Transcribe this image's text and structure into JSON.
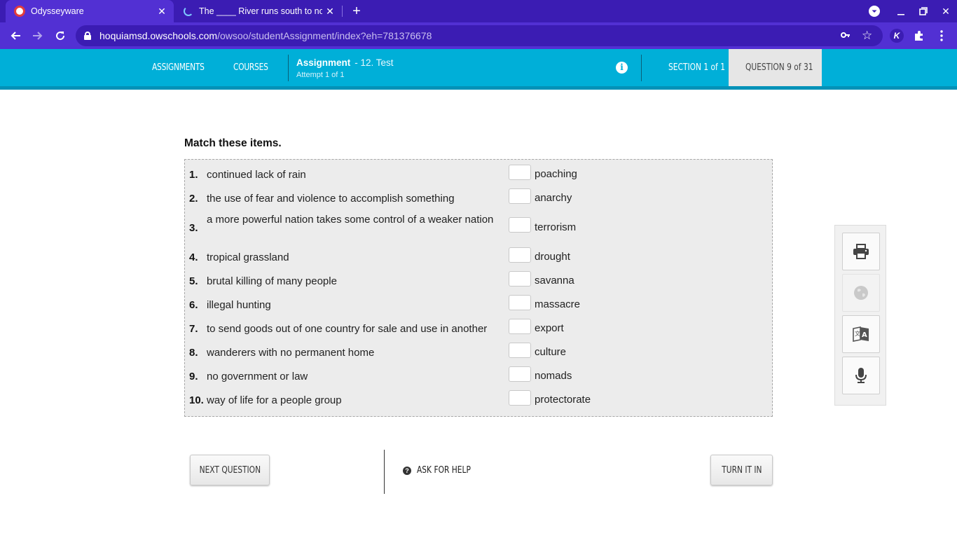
{
  "browser": {
    "tabs": [
      {
        "title": "Odysseyware",
        "active": true
      },
      {
        "title": "The ____ River runs south to nor",
        "active": false
      }
    ],
    "url_domain": "hoquiamsd.owschools.com",
    "url_path": "/owsoo/studentAssignment/index?eh=781376678",
    "accent_color": "#5230d3"
  },
  "header": {
    "nav": [
      "ASSIGNMENTS",
      "COURSES"
    ],
    "assignment_label": "Assignment",
    "assignment_name": "- 12. Test",
    "attempt": "Attempt 1 of 1",
    "section": "SECTION 1 of 1",
    "question": "QUESTION 9 of 31",
    "accent_color": "#00afd8"
  },
  "content": {
    "prompt": "Match these items.",
    "items": [
      {
        "num": "1.",
        "term": "continued lack of rain",
        "answer": "",
        "option": "poaching"
      },
      {
        "num": "2.",
        "term": "the use of fear and violence to accomplish something",
        "answer": "",
        "option": "anarchy"
      },
      {
        "num": "3.",
        "term": "a more powerful nation takes some control of a weaker nation",
        "answer": "",
        "option": "terrorism"
      },
      {
        "num": "4.",
        "term": "tropical grassland",
        "answer": "",
        "option": "drought"
      },
      {
        "num": "5.",
        "term": "brutal killing of many people",
        "answer": "",
        "option": "savanna"
      },
      {
        "num": "6.",
        "term": "illegal hunting",
        "answer": "",
        "option": "massacre"
      },
      {
        "num": "7.",
        "term": "to send goods out of one country for sale and use in another",
        "answer": "",
        "option": "export"
      },
      {
        "num": "8.",
        "term": "wanderers with no permanent home",
        "answer": "",
        "option": "culture"
      },
      {
        "num": "9.",
        "term": "no government or law",
        "answer": "",
        "option": "nomads"
      },
      {
        "num": "10.",
        "term": "way of life for a people group",
        "answer": "",
        "option": "protectorate"
      }
    ]
  },
  "tools": [
    "print-icon",
    "globe-icon",
    "translate-icon",
    "microphone-icon"
  ],
  "footer": {
    "next": "NEXT QUESTION",
    "help": "ASK FOR HELP",
    "turn_in": "TURN IT IN"
  }
}
